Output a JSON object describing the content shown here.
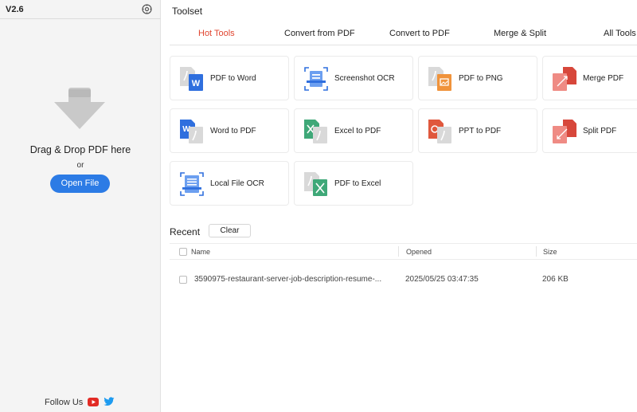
{
  "app": {
    "version": "V2.6"
  },
  "sidebar": {
    "drop_text": "Drag & Drop PDF here",
    "or_text": "or",
    "open_button": "Open File",
    "follow_text": "Follow Us"
  },
  "toolset": {
    "title": "Toolset",
    "tabs": [
      {
        "label": "Hot Tools",
        "active": true
      },
      {
        "label": "Convert from PDF"
      },
      {
        "label": "Convert to PDF"
      },
      {
        "label": "Merge & Split"
      },
      {
        "label": "All Tools"
      }
    ],
    "tools": [
      {
        "label": "PDF to Word",
        "icon": "pdf-to-word-icon"
      },
      {
        "label": "Screenshot OCR",
        "icon": "screenshot-ocr-icon"
      },
      {
        "label": "PDF to PNG",
        "icon": "pdf-to-png-icon"
      },
      {
        "label": "Merge PDF",
        "icon": "merge-pdf-icon"
      },
      {
        "label": "Word to PDF",
        "icon": "word-to-pdf-icon"
      },
      {
        "label": "Excel to PDF",
        "icon": "excel-to-pdf-icon"
      },
      {
        "label": "PPT to PDF",
        "icon": "ppt-to-pdf-icon"
      },
      {
        "label": "Split PDF",
        "icon": "split-pdf-icon"
      },
      {
        "label": "Local File OCR",
        "icon": "local-file-ocr-icon"
      },
      {
        "label": "PDF to Excel",
        "icon": "pdf-to-excel-icon"
      }
    ]
  },
  "recent": {
    "title": "Recent",
    "clear_button": "Clear",
    "columns": {
      "name": "Name",
      "opened": "Opened",
      "size": "Size"
    },
    "files": [
      {
        "name": "3590975-restaurant-server-job-description-resume-...",
        "opened": "2025/05/25 03:47:35",
        "size": "206 KB"
      }
    ]
  },
  "colors": {
    "accent": "#2c7be5",
    "active_tab": "#e0442f",
    "sidebar_bg": "#f4f4f4"
  }
}
